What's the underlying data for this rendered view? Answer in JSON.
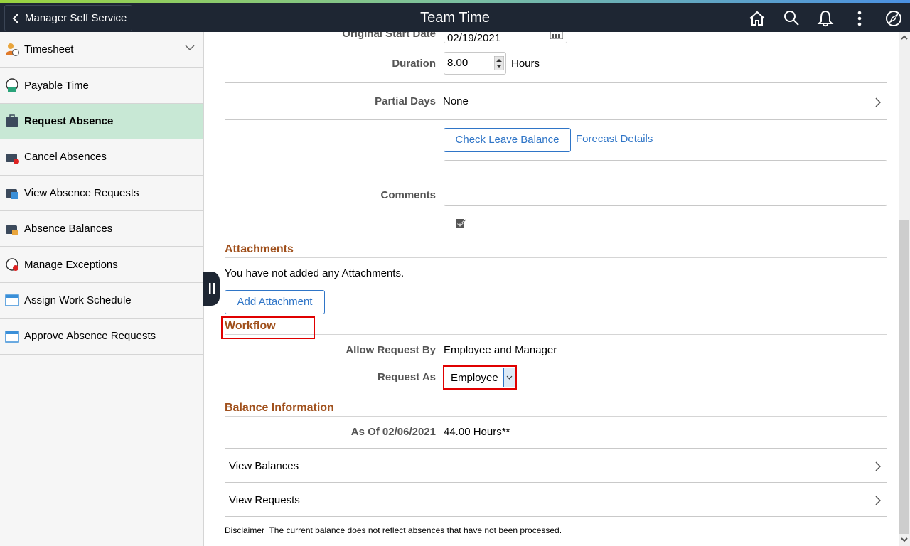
{
  "header": {
    "back_label": "Manager Self Service",
    "title": "Team Time",
    "icons": [
      "home-icon",
      "search-icon",
      "bell-icon",
      "more-icon",
      "compass-icon"
    ]
  },
  "sidebar": {
    "items": [
      {
        "label": "Timesheet",
        "icon": "timesheet-icon"
      },
      {
        "label": "Payable Time",
        "icon": "payable-time-icon"
      },
      {
        "label": "Request Absence",
        "icon": "briefcase-icon",
        "active": true
      },
      {
        "label": "Cancel Absences",
        "icon": "cancel-absence-icon"
      },
      {
        "label": "View Absence Requests",
        "icon": "view-requests-icon"
      },
      {
        "label": "Absence Balances",
        "icon": "balances-icon"
      },
      {
        "label": "Manage Exceptions",
        "icon": "exceptions-icon"
      },
      {
        "label": "Assign Work Schedule",
        "icon": "schedule-icon"
      },
      {
        "label": "Approve Absence Requests",
        "icon": "approve-icon"
      }
    ]
  },
  "form": {
    "original_start_date_label": "Original Start Date",
    "original_start_date": "02/19/2021",
    "duration_label": "Duration",
    "duration": "8.00",
    "duration_unit": "Hours",
    "partial_days_label": "Partial Days",
    "partial_days": "None",
    "check_leave_balance": "Check Leave Balance",
    "forecast_details": "Forecast Details",
    "comments_label": "Comments",
    "comments": ""
  },
  "attachments": {
    "heading": "Attachments",
    "empty_text": "You have not added any Attachments.",
    "add_button": "Add Attachment"
  },
  "workflow": {
    "heading": "Workflow",
    "allow_request_by_label": "Allow Request By",
    "allow_request_by": "Employee and Manager",
    "request_as_label": "Request As",
    "request_as": "Employee"
  },
  "balance": {
    "heading": "Balance Information",
    "as_of_label": "As Of 02/06/2021",
    "as_of_value": "44.00 Hours**",
    "view_balances": "View Balances",
    "view_requests": "View Requests",
    "disclaimer_label": "Disclaimer",
    "disclaimer_text": "The current balance does not reflect absences that have not been processed."
  }
}
